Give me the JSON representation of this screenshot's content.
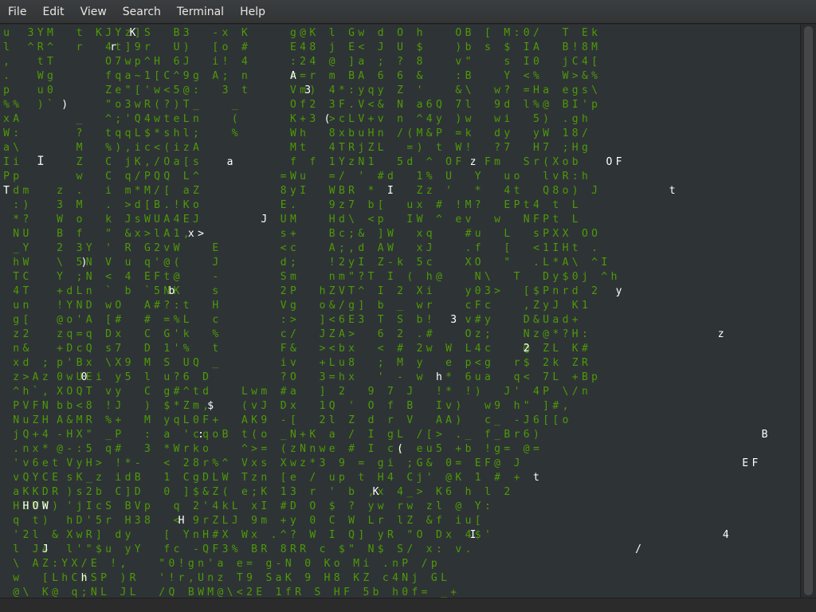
{
  "menubar": {
    "items": [
      {
        "label": "File"
      },
      {
        "label": "Edit"
      },
      {
        "label": "View"
      },
      {
        "label": "Search"
      },
      {
        "label": "Terminal"
      },
      {
        "label": "Help"
      }
    ]
  },
  "terminal": {
    "background": "#2e3436",
    "glyph_color": "#4e9a06",
    "highlight_color": "#ffffff",
    "rows": [
      "u    3 Y M     t   K J Y z ] S     B 3     - x   K         g @ K   l   G w   d   O   h       O B   [   M : 0 /     T   E k",
      "l    ^ R ^     r     4 t ] 9 r     U )     [ o   #         E 4 8   j   E <   J   U   $       ) b   s   $   I A     B ! 8 M",
      ",      t T           O 7 w p ^ H   6 J     i !   4         : 2 4   @   ] a   ;   ?   8       v \"       s   I 0     j C 4 [",
      ".      W g           f q a ~ 1 [ C ^ 9 g   A ;   n         r = r   m   B A   6   6   &       : B       Y   < %     W > & %",
      "p      u 0           Z e \" [ ' w < 5 @ :     3   t         V m )   4 * : y q y   Z   '       & \\     w ?   = H a   e g s \\",
      "% %    ) `           \" o 3 w R ( ? ) T _       _           O f 2   3 F . V < &   N   a 6 Q   7 l     9 d   l % @   B I ' p",
      "x A            _     ^ ; ' Q 4 w t e L n       (           K + 3   > c L V + v   n   ^ 4 y   ) w     w i     5 )   . g h",
      "W :            ?     t q q L $ * s h l ;       %           W h     8 x b u H n   / ( M & P   = k     d y     y W   1 8 /",
      "a \\            M     % ) , i c < ( i z A                   M t     4 T R j Z L     = )   t   W !     ? 7     H 7   ; H g",
      "I i            Z     C   j K , / O a [ s                   f   f   1 Y z N 1     5 d   ^   O F     F m     S r ( X o b",
      "P p            w     C   q / P Q Q   L ^                 = W u     = /   '   # d     1 %   U     Y     u o     l v R : h",
      "T d m      z   .     i   m * M / [   a Z                 8 y I     W B R   *   '     Z z   '     *     4 t     Q 8 o )   J",
      "  : )      3   M     .   > d [ B . ! K o                 E .       9 z 7   b [     u x   #   ! M ?     E P t 4   t   L",
      "  * ?      W   o     k   J s W U A 4 E J                 U M       H d \\   < p     I W   ^   e v     w     N F P t   L",
      "  N U      B   f     \"   & x > l A 1 ,                   s +       B c ; &   ] W     x q       # u     L     s P X X   O O",
      "  _ Y      2   3 Y   '   R   G 2 v W       E             < c       A ; , d   A W     x J       . f     [     < 1 I H t   .",
      "  h W      \\   5 N   V   u   q ' @ (       J             d ;       ! 2 y I   Z - k   5 c       X O     \"     . L * A \\   ^ I",
      "  T C      Y   ; N   <   4   E F t @       -             S m       n m \" ? T   I   (   h @       N \\     T     D y $ 0 j   ^ h",
      "  4 T      + d L n   `   b   ` 5 N K       s             2 P     h Z V T ^   I   2   X i       y 0 3 >     [ $ P n r d   2",
      "  u n      ! Y N D   w O     A # ? : t     H             V g     o & / g ]   b   _   w r       c F c       , Z y J   K 1",
      "  g [      @ o ' A   [ #     #   = % L     c             : >     ] < 6 E 3   T   S   b !       v # y       D & U a d +",
      "  z 2      z q = q   D x     C   G ' k     %             c /     J Z A >     6   2   . #       O z ;       N z @ * ? H :",
      "  n &      + D c Q   s 7     D   1 ' %     t             F &     > < b x     <   #   2 w   W   L 4 c       @   Z L   K #",
      "  x d   ;  p ' B x   \\ X 9   M   S   U Q   _             i v     + L u 8     ;   M   y     e   p < g     r $   2 k   Z R",
      "  z > A z  0 w U E i   y 5   l   u ? 6   D               ? O     3 = h x     '   -   w     *   6 u a     q <   7 L   + B p",
      "  ^ h ` ,  X O Q T   v y     C   g # ^ t d       L w m   # a     ]   2     9   7   J     ! *   ! )     J '   4 P   \\ / n",
      "  P V F N  b b < 8   ! J     )   $ * Z m ,       ( v J   D x     1 Q   '   O   f   B     I v )     w 9   h \"   ] # ,",
      "  N u Z H  A & M R   % +     M   y q L 0 F +     A K 9   - [     2 l   Z   d   r   V     A A )     c _   - J 6 [ [ o",
      "  j Q + 4  - H X \"   _ P     :   a   ' c q o B   t ( o   _ N + K   a   /   I   g L   / [ >   . _   f _ B r 6 )",
      "  . n x *  @ - : 5   q #     3   * W r k o       ^ > =   ( z N n w e   #   I   c ;   e u 5   + b   ! g =   @ =",
      "  ' v 6 e t  V y H >   ! * -     <   2 8 r % ^   V x s   X w z * 3   9   =   g i   ; G &   0 =   E F @   J",
      "  v Q Y C E  s K _ z   i d B     1   C g D L W   T z n   [ e   /   u p   t   H 4   C j '   @ K   1   #   +",
      "  a K K D R  ) s 2 b   C ] D     0   ] $ & Z (   e ; K   1 3   r   '   b   , x   4 _ >   K 6   h   l   2",
      "  H O W N )  ' j I c S   B V p     q   2 ' 4 k L   x I   # D   O   $   ?   y w   r w   z l   @   Y :",
      "  q   t )    h D ' 5 r   H 3 8     <   9 r Z L J   9 m   + y   0   C   W   L r   l Z   & f   i u [",
      "  ' 2 l   &  X w R ]   d y       [   Y n H # X   W x   . ^ ?   W   I   Q ]   y R   \" O   D x   4 $ '",
      "  l   J 4    l ' \" $ u   y Y     f c   - Q F 3 %   B R   8 R R   c   $ \"   N $   S /   x :   v .",
      "  \\   A Z : Y X / E   ! ,       \" 0 ! g n ' a   e =   g - N   0   K o   M i   . n P   / p",
      "  w     [ L h C / S P   ) R     ' ! r , U n z   T 9   S a K   9   H 8   K Z   c 4 N j   G L",
      "  @ \\   K @   q ; N L   J L     / Q   B W M @ \\ < 2 E   1 f R   S   H F   5 b   h 0 f =   _ +"
    ]
  },
  "icons": {
    "cursor": "ibeam-cursor-icon"
  }
}
